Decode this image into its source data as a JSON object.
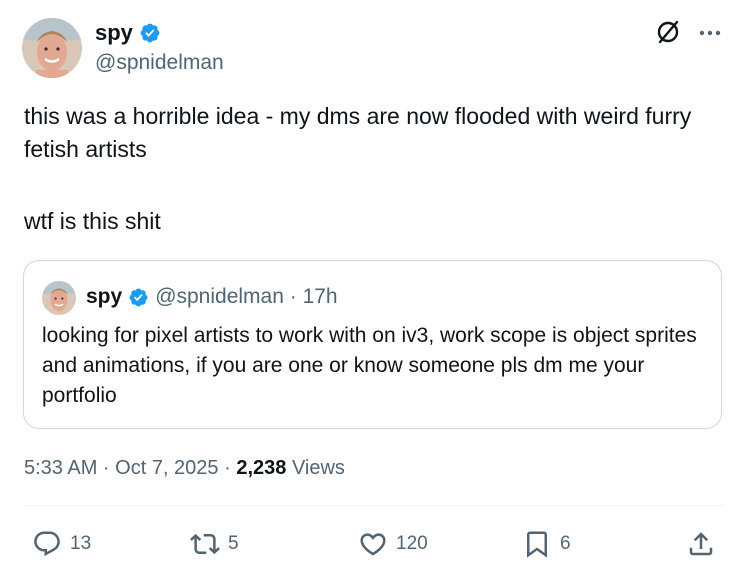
{
  "tweet": {
    "author_name": "spy",
    "handle": "@spnidelman",
    "text_paragraphs": [
      "this was a horrible idea - my dms are now flooded with weird furry fetish artists",
      "wtf is this shit"
    ],
    "timestamp": "5:33 AM · Oct 7, 2025 · ",
    "views_count": "2,238",
    "views_label": " Views"
  },
  "quote": {
    "author_name": "spy",
    "handle_time": "@spnidelman · 17h",
    "text": "looking for pixel artists to work with on iv3, work scope is object sprites and animations, if you are one or know someone pls dm me your portfolio"
  },
  "actions": {
    "reply_count": "13",
    "retweet_count": "5",
    "like_count": "120",
    "bookmark_count": "6"
  },
  "colors": {
    "verified_blue": "#1d9bf0",
    "secondary_text": "#536471",
    "primary_text": "#0f1419"
  },
  "icons": [
    "verified-badge-icon",
    "grok-icon",
    "more-icon",
    "reply-icon",
    "retweet-icon",
    "like-icon",
    "bookmark-icon",
    "share-icon"
  ]
}
